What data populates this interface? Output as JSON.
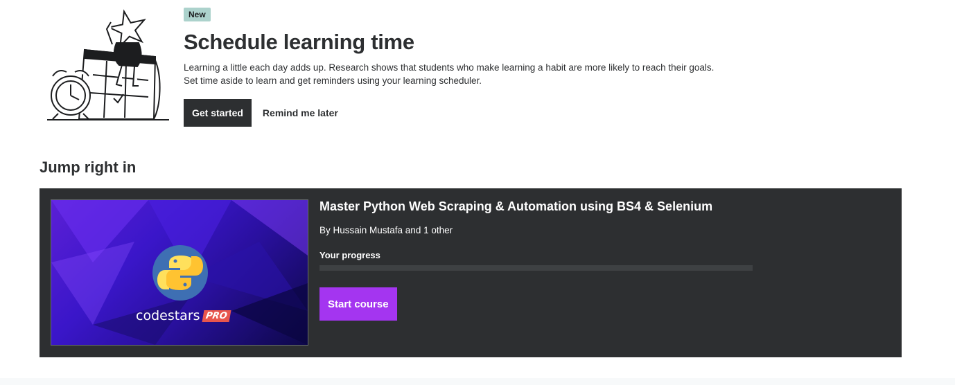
{
  "promo": {
    "badge": "New",
    "title": "Schedule learning time",
    "desc_line1": "Learning a little each day adds up. Research shows that students who make learning a habit are more likely to reach their goals.",
    "desc_line2": "Set time aside to learn and get reminders using your learning scheduler.",
    "primary_label": "Get started",
    "secondary_label": "Remind me later"
  },
  "section": {
    "title": "Jump right in"
  },
  "course": {
    "title": "Master Python Web Scraping & Automation using BS4 & Selenium",
    "author": "By Hussain Mustafa and 1 other",
    "progress_label": "Your progress",
    "progress_fraction": 0,
    "cta_label": "Start course",
    "thumb_brand": "codestars",
    "thumb_badge": "PRO"
  },
  "colors": {
    "accent": "#a435f0",
    "dark": "#2d2f31",
    "badge_bg": "#acd2cc"
  }
}
